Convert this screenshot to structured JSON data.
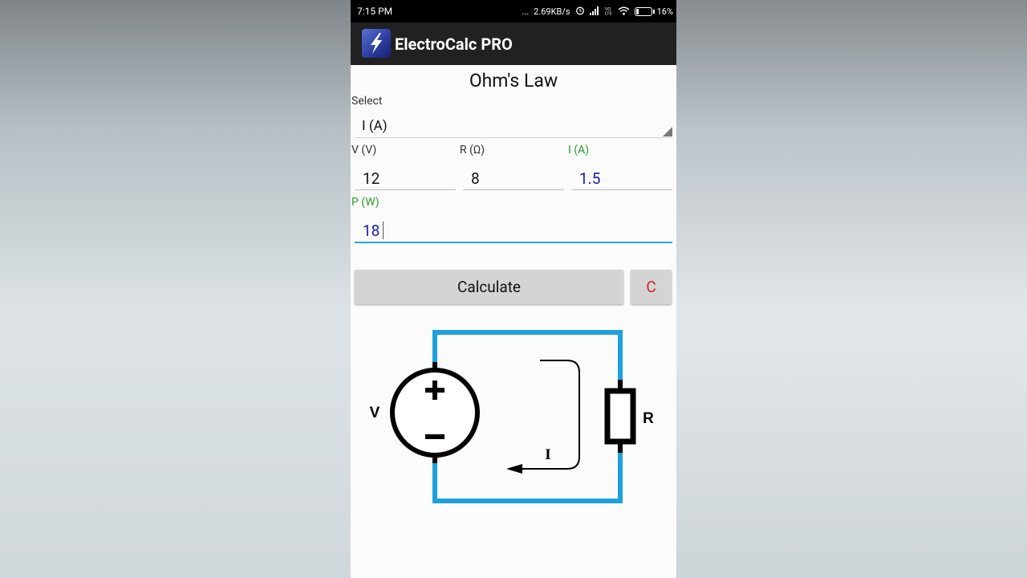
{
  "status_bar": {
    "time": "7:15 PM",
    "dots": "...",
    "speed": "2.69KB/s",
    "battery_percent": "16%",
    "battery_level": 0.16
  },
  "app_bar": {
    "title": "ElectroCalc PRO",
    "logo_icon": "lightning-bolt-icon"
  },
  "screen": {
    "title": "Ohm's Law",
    "select_label": "Select",
    "select_value": "I (A)",
    "fields": {
      "v": {
        "label": "V (V)",
        "value": "12",
        "computed": false
      },
      "r": {
        "label": "R (Ω)",
        "value": "8",
        "computed": false
      },
      "i": {
        "label": "I (A)",
        "value": "1.5",
        "computed": true
      },
      "p": {
        "label": "P (W)",
        "value": "18",
        "computed": true
      }
    },
    "calculate_label": "Calculate",
    "clear_label": "C"
  },
  "diagram": {
    "v_label": "V",
    "r_label": "R",
    "i_label": "I",
    "plus": "+",
    "minus": "−"
  },
  "colors": {
    "wire": "#1ea0dc",
    "computed_label": "#2e9d2e",
    "computed_value": "#1a1aa8",
    "clear_text": "#d31f1f",
    "focus_underline": "#2aa7d8"
  }
}
